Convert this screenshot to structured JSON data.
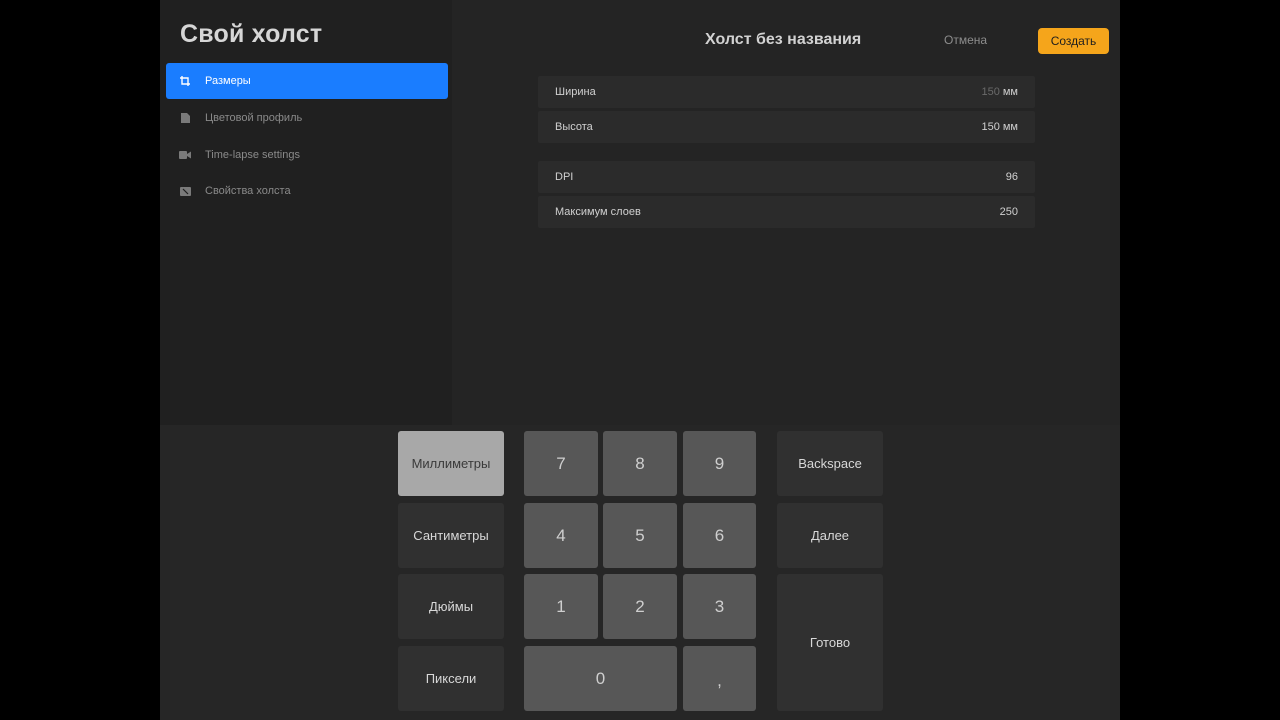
{
  "sidebar": {
    "title": "Свой холст",
    "items": [
      {
        "label": "Размеры",
        "icon": "crop-icon",
        "active": true
      },
      {
        "label": "Цветовой профиль",
        "icon": "document-icon",
        "active": false
      },
      {
        "label": "Time-lapse settings",
        "icon": "video-camera-icon",
        "active": false
      },
      {
        "label": "Свойства холста",
        "icon": "canvas-properties-icon",
        "active": false
      }
    ]
  },
  "header": {
    "title": "Холст без названия",
    "cancel_label": "Отмена",
    "create_label": "Создать"
  },
  "settings": {
    "width": {
      "label": "Ширина",
      "value": "150",
      "unit": " мм"
    },
    "height": {
      "label": "Высота",
      "value": "150 мм"
    },
    "dpi": {
      "label": "DPI",
      "value": "96"
    },
    "max_layers": {
      "label": "Максимум слоев",
      "value": "250"
    }
  },
  "keypad": {
    "units": [
      "Миллиметры",
      "Сантиметры",
      "Дюймы",
      "Пиксели"
    ],
    "selected_unit": "Миллиметры",
    "digits": [
      "7",
      "8",
      "9",
      "4",
      "5",
      "6",
      "1",
      "2",
      "3",
      "0",
      ","
    ],
    "backspace_label": "Backspace",
    "next_label": "Далее",
    "done_label": "Готово"
  },
  "colors": {
    "accent_blue": "#1a7dff",
    "create_orange": "#f5a51b"
  }
}
